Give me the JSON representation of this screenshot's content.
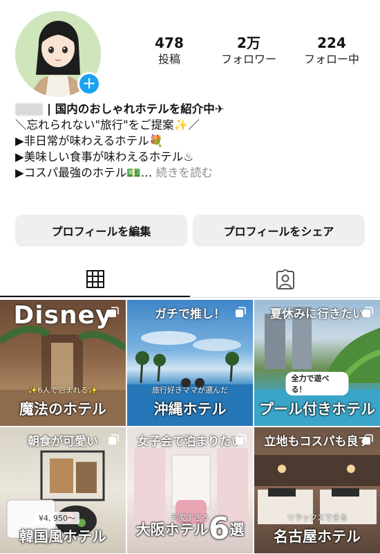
{
  "profile": {
    "stats": [
      {
        "value": "478",
        "label": "投稿"
      },
      {
        "value": "2万",
        "label": "フォロワー"
      },
      {
        "value": "224",
        "label": "フォロー中"
      }
    ],
    "add_icon": "plus-icon",
    "accent_color": "#1aa1f2"
  },
  "bio": {
    "name_suffix": "| 国内のおしゃれホテルを紹介中✈",
    "lines": [
      "＼忘れられない\"旅行\"をご提案✨／",
      "▶非日常が味わえるホテル💐",
      "▶美味しい食事が味わえるホテル♨",
      "▶コスパ最強のホテル💵…"
    ],
    "more_label": "続きを読む"
  },
  "buttons": {
    "edit_profile": "プロフィールを編集",
    "share_profile": "プロフィールをシェア"
  },
  "tabs": [
    {
      "name": "posts-grid",
      "icon": "grid-icon",
      "active": true
    },
    {
      "name": "tagged",
      "icon": "tagged-person-icon",
      "active": false
    }
  ],
  "posts": [
    {
      "top": "Disney",
      "sub": "✨6人で泊まれる✨",
      "bottom": "魔法のホテル"
    },
    {
      "top": "ガチで推し！",
      "sub": "旅行好きママが選んだ",
      "bottom": "沖縄ホテル"
    },
    {
      "top": "夏休みに行きたい",
      "pill": "全力で遊べる！",
      "bottom": "プール付きホテル"
    },
    {
      "top": "朝食が可愛い",
      "price": "¥4, 950〜",
      "bottom": "韓国風ホテル"
    },
    {
      "top": "女子会で泊まりたい",
      "sub": "可愛すぎる",
      "bottom_a": "大阪ホテル",
      "bottom_b": "6",
      "bottom_c": "選"
    },
    {
      "top": "立地もコスパも良す",
      "sub": "リラックスできる",
      "bottom": "名古屋ホテル"
    }
  ]
}
